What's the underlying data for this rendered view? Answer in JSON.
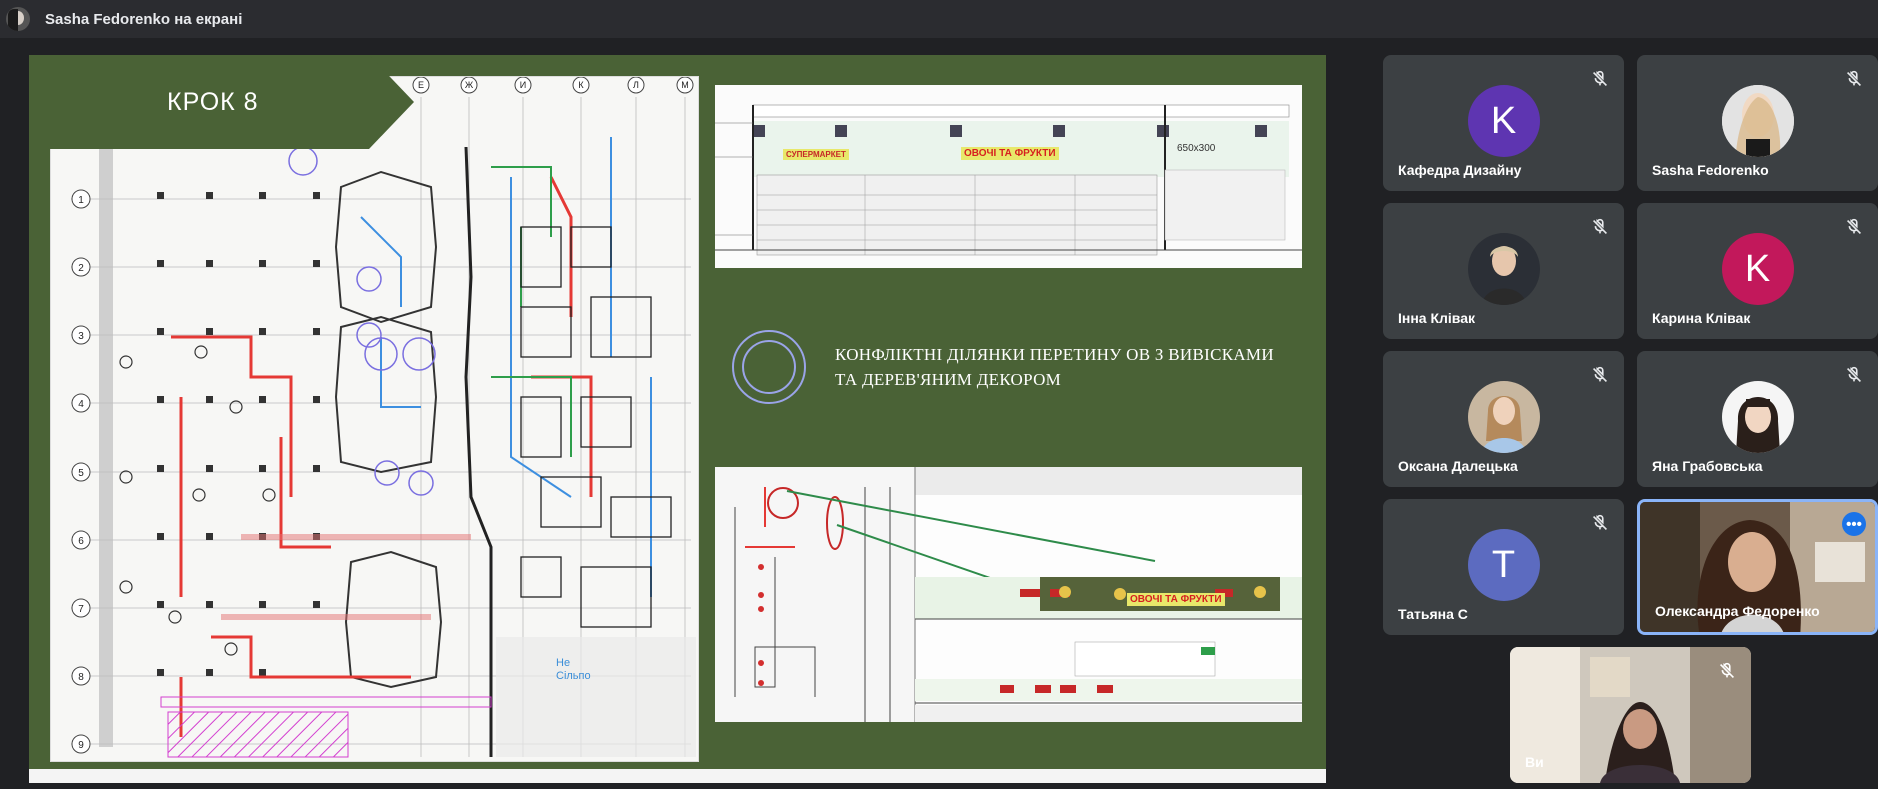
{
  "topbar": {
    "presenter_name": "Sasha Fedorenko на екрані"
  },
  "slide": {
    "step_label": "КРОК 8",
    "conflict_text_line1": "КОНФЛІКТНІ ДІЛЯНКИ ПЕРЕТИНУ ОВ З ВИВІСКАМИ",
    "conflict_text_line2": "ТА ДЕРЕВ'ЯНИМ ДЕКОРОМ",
    "plan_label_ne": "Не\nСільпо",
    "sign_top": "ОВОЧІ ТА ФРУКТИ",
    "sign_top_left": "СУПЕРМАРКЕТ",
    "sign_bottom": "ОВОЧІ ТА ФРУКТИ",
    "box_label": "650x300",
    "grid_cols": [
      "Е",
      "Ж",
      "И",
      "К",
      "Л",
      "М"
    ],
    "grid_rows": [
      "1",
      "2",
      "3",
      "4",
      "5",
      "6",
      "7",
      "8",
      "9"
    ]
  },
  "participants": [
    {
      "name": "Кафедра Дизайну",
      "avatar_letter": "K",
      "avatar_color": "#5e35b1",
      "muted": true
    },
    {
      "name": "Sasha Fedorenko",
      "avatar_type": "photo",
      "muted": true
    },
    {
      "name": "Інна Клівак",
      "avatar_type": "photo",
      "muted": true
    },
    {
      "name": "Карина Клівак",
      "avatar_letter": "K",
      "avatar_color": "#c2185b",
      "muted": true
    },
    {
      "name": "Оксана Далецька",
      "avatar_type": "photo",
      "muted": true
    },
    {
      "name": "Яна Грабовська",
      "avatar_type": "photo",
      "muted": true
    },
    {
      "name": "Татьяна С",
      "avatar_letter": "T",
      "avatar_color": "#5c6bc0",
      "muted": true
    },
    {
      "name": "Олександра Федоренко",
      "avatar_type": "video",
      "speaking": true
    },
    {
      "name": "Ви",
      "avatar_type": "video",
      "muted": true
    }
  ],
  "colors": {
    "slide_green": "#4a6236",
    "accent_blue": "#8ab4f8",
    "tile_bg": "#3c4043"
  }
}
